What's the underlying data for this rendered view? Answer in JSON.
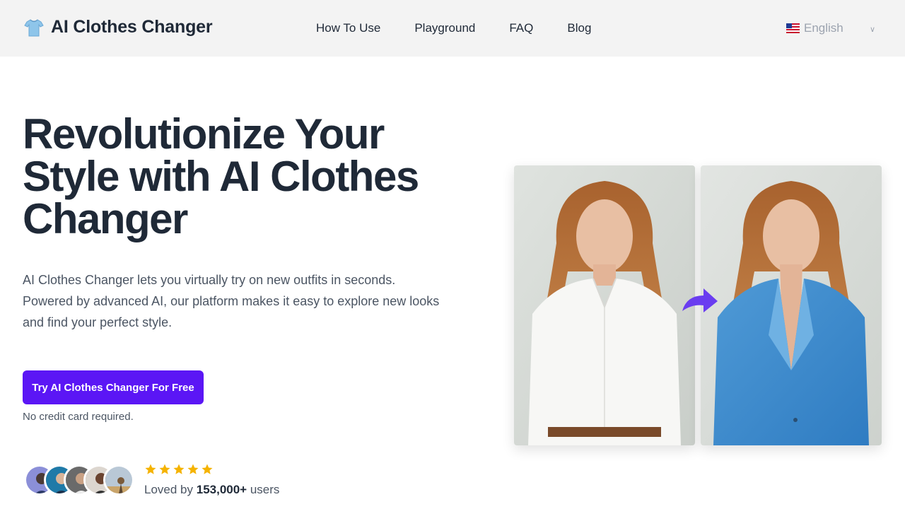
{
  "header": {
    "brand_name": "AI Clothes Changer",
    "brand_icon": "tshirt-icon",
    "nav": [
      "How To Use",
      "Playground",
      "FAQ",
      "Blog"
    ],
    "language": "English",
    "language_flag": "us-flag-icon"
  },
  "hero": {
    "title": "Revolutionize Your Style with AI Clothes Changer",
    "description": "AI Clothes Changer lets you virtually try on new outfits in seconds. Powered by advanced AI, our platform makes it easy to explore new looks and find your perfect style.",
    "cta_label": "Try AI Clothes Changer For Free",
    "note": "No credit card required."
  },
  "social_proof": {
    "rating_stars": 5,
    "loved_prefix": "Loved by ",
    "user_count": "153,000+",
    "loved_suffix": " users"
  },
  "colors": {
    "accent": "#5b16f5",
    "star": "#f5b301",
    "header_bg": "#f3f3f3"
  }
}
